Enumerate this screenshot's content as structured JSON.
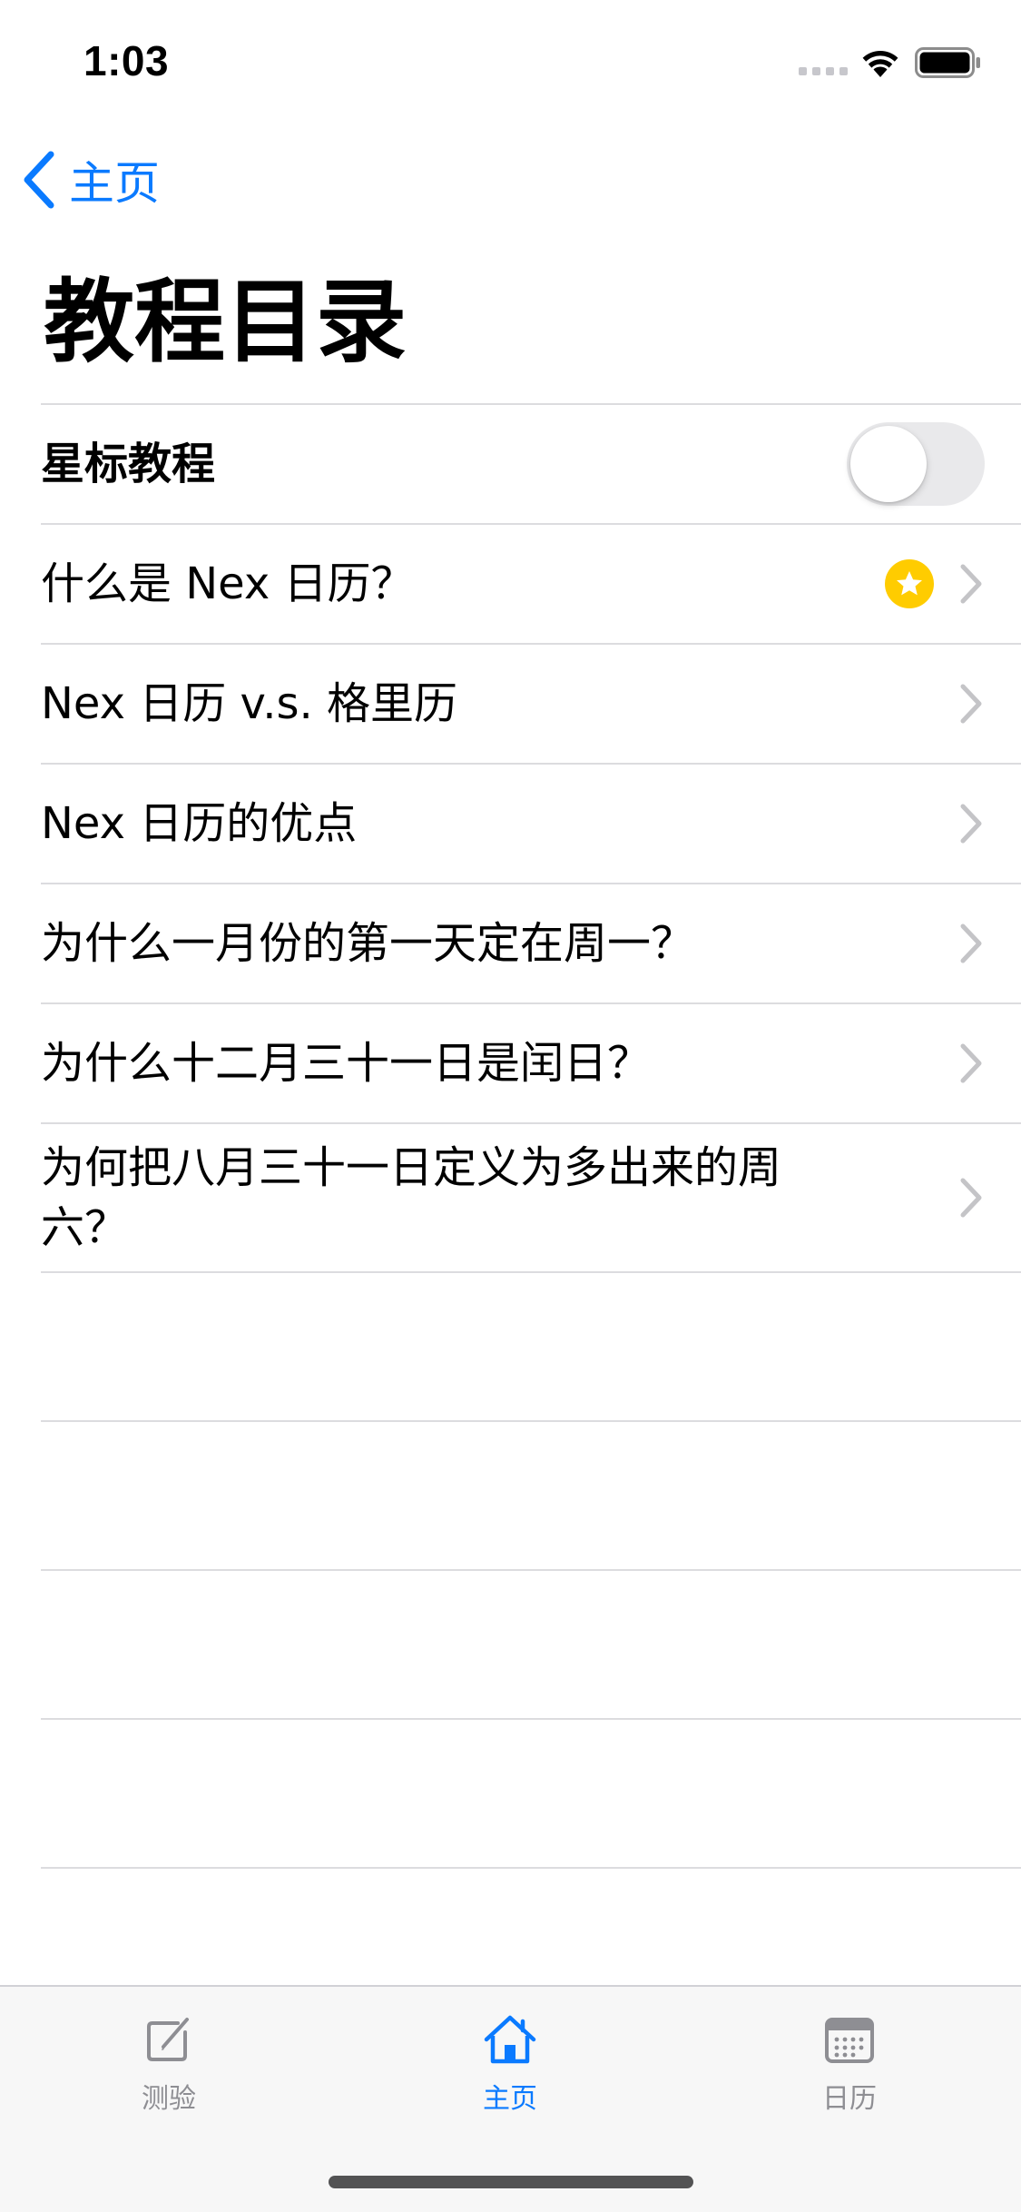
{
  "status_bar": {
    "time": "1:03"
  },
  "nav": {
    "back_label": "主页",
    "title": "教程目录"
  },
  "list": {
    "starred_toggle": {
      "label": "星标教程",
      "on": false
    },
    "items": [
      {
        "label": "什么是 Nex 日历？",
        "starred": true
      },
      {
        "label": "Nex 日历 v.s. 格里历",
        "starred": false
      },
      {
        "label": "Nex 日历的优点",
        "starred": false
      },
      {
        "label": "为什么一月份的第一天定在周一？",
        "starred": false
      },
      {
        "label": "为什么十二月三十一日是闰日？",
        "starred": false
      },
      {
        "label": "为何把八月三十一日定义为多出来的周六？",
        "starred": false
      }
    ]
  },
  "tab_bar": {
    "tabs": [
      {
        "label": "测验",
        "icon": "compose-icon",
        "active": false
      },
      {
        "label": "主页",
        "icon": "house-icon",
        "active": true
      },
      {
        "label": "日历",
        "icon": "calendar-icon",
        "active": false
      }
    ]
  },
  "colors": {
    "accent": "#0a7aff",
    "star": "#ffcc00",
    "separator": "#dcdcdf",
    "inactive_tab": "#8e8e93"
  }
}
